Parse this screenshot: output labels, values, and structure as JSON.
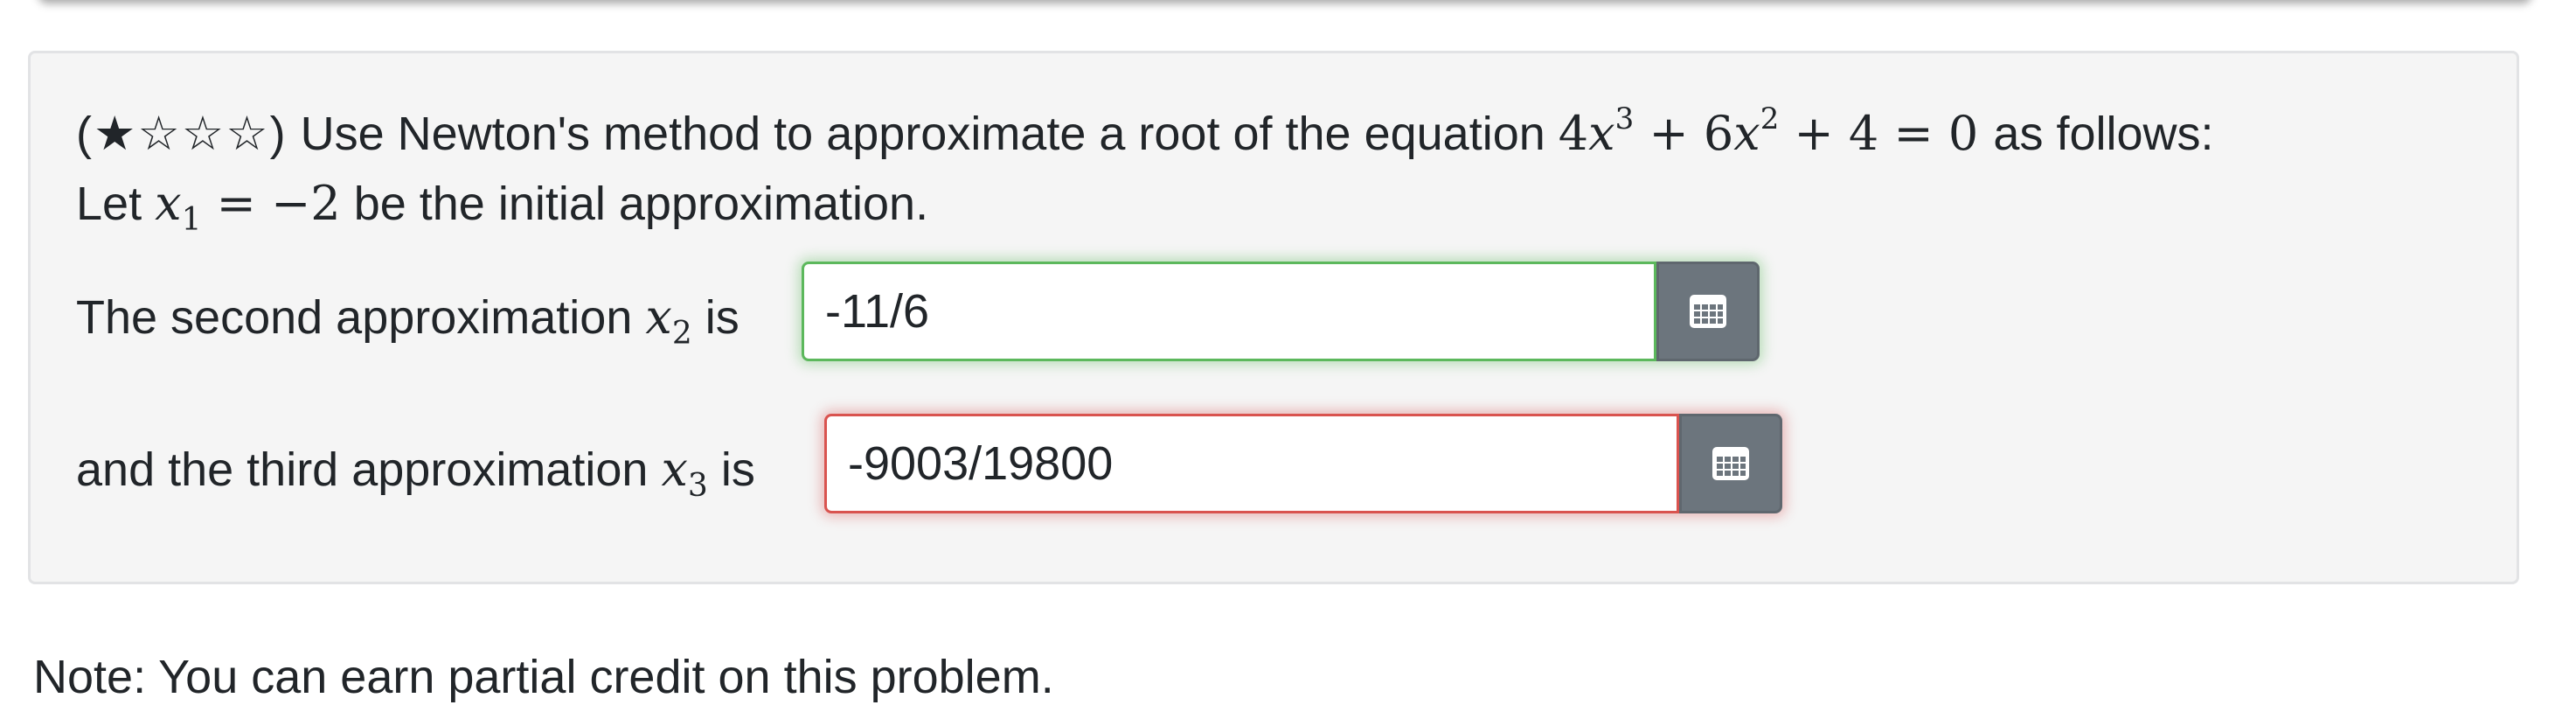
{
  "question": {
    "stars": "(★☆☆☆)",
    "intro": "Use Newton's method to approximate a root of the equation",
    "equation": {
      "term1_coef": "4",
      "term1_var": "x",
      "term1_exp": "3",
      "op1": "+",
      "term2_coef": "6",
      "term2_var": "x",
      "term2_exp": "2",
      "op2": "+",
      "const": "4",
      "eq": "=",
      "rhs": "0"
    },
    "tail": "as follows:",
    "line2_prefix": "Let",
    "x1_var": "x",
    "x1_sub": "1",
    "x1_eq": "=",
    "x1_val": "−2",
    "line2_suffix": "be the initial approximation."
  },
  "answers": [
    {
      "label_prefix": "The second approximation",
      "var": "x",
      "sub": "2",
      "label_suffix": "is",
      "value": "-11/6",
      "status": "correct"
    },
    {
      "label_prefix": "and the third approximation",
      "var": "x",
      "sub": "3",
      "label_suffix": "is",
      "value": "-9003/19800",
      "status": "incorrect"
    }
  ],
  "icons": {
    "matrix_button": "grid-icon"
  },
  "colors": {
    "correct": "#5cb85c",
    "incorrect": "#d9534f",
    "button": "#6c757d",
    "card_bg": "#f5f5f5"
  },
  "note_partial": "Note: You can earn partial credit on this problem."
}
